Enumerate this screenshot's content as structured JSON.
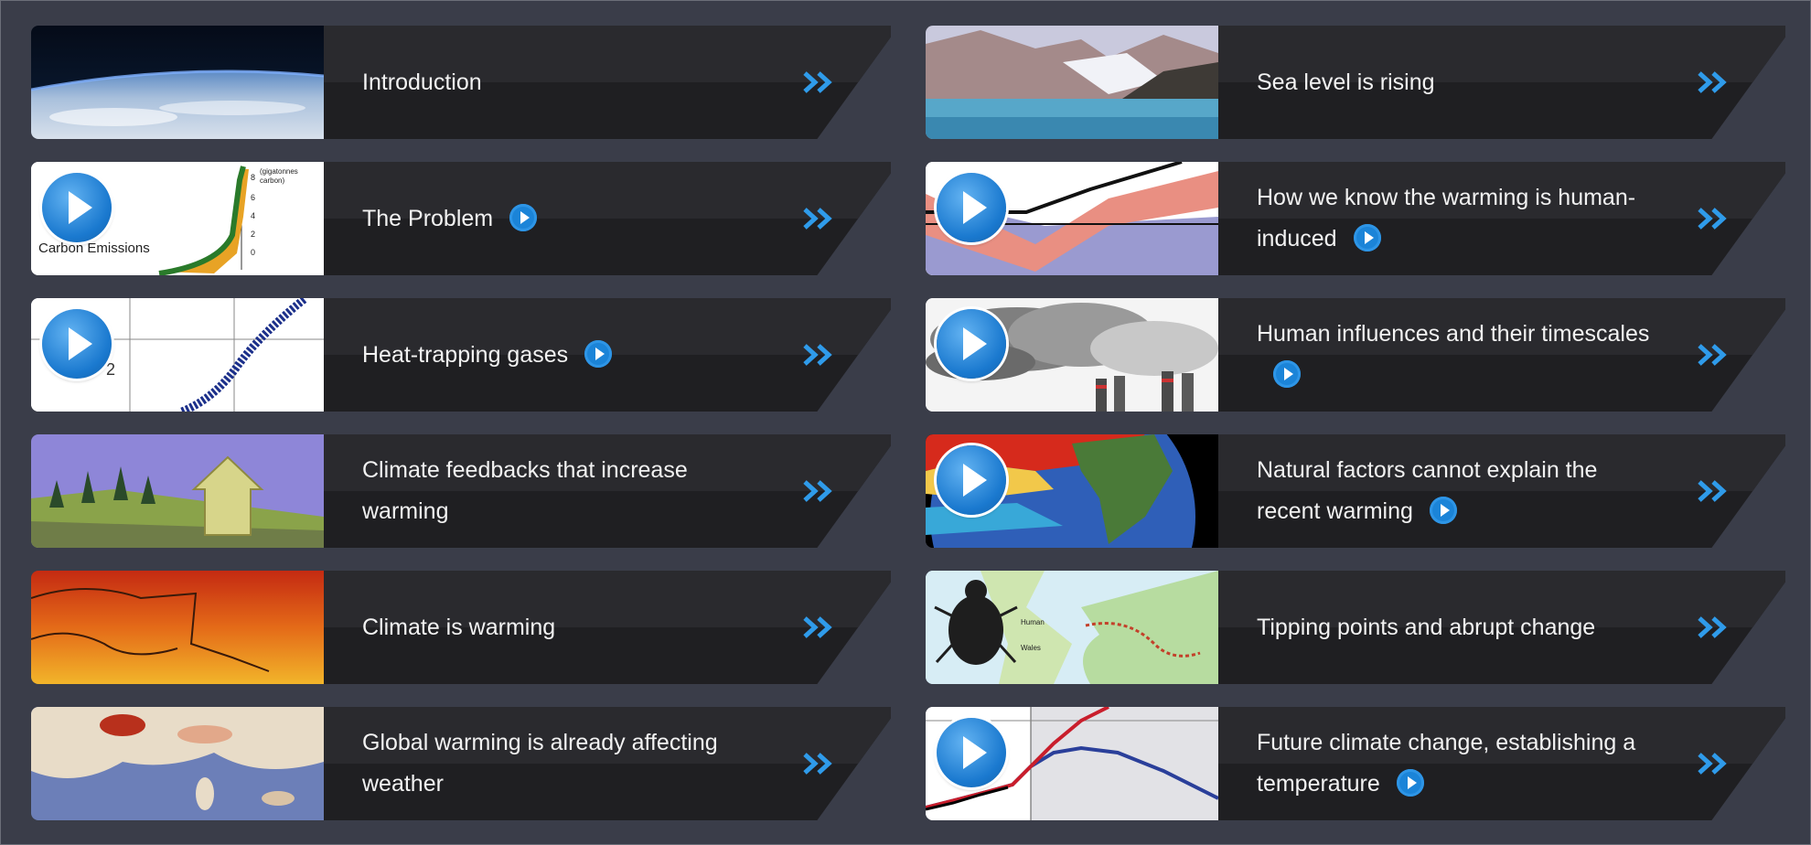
{
  "cards": [
    {
      "label": "Introduction",
      "has_play": false,
      "thumb_play": false
    },
    {
      "label": "Sea level is rising",
      "has_play": false,
      "thumb_play": false
    },
    {
      "label": "The Problem",
      "has_play": true,
      "thumb_play": true
    },
    {
      "label": "How we know the warming is human-induced",
      "has_play": true,
      "thumb_play": true
    },
    {
      "label": "Heat-trapping gases",
      "has_play": true,
      "thumb_play": true
    },
    {
      "label": "Human influences and their timescales",
      "has_play": true,
      "thumb_play": true
    },
    {
      "label": "Climate feedbacks that increase warming",
      "has_play": false,
      "thumb_play": false
    },
    {
      "label": "Natural factors cannot explain the recent warming",
      "has_play": true,
      "thumb_play": true
    },
    {
      "label": "Climate is warming",
      "has_play": false,
      "thumb_play": false
    },
    {
      "label": "Tipping points and abrupt change",
      "has_play": false,
      "thumb_play": false
    },
    {
      "label": "Global warming is already affecting weather",
      "has_play": false,
      "thumb_play": false
    },
    {
      "label": "Future climate change, establishing a temperature",
      "has_play": true,
      "thumb_play": true
    }
  ],
  "thumb_text": {
    "carbon": "Carbon Emissions",
    "gigatonnes": "(gigatonnes carbon)",
    "co2_subscript": "2",
    "human_label": "Human",
    "map_label": "Wales"
  },
  "colors": {
    "accent": "#1b84d8",
    "chevron": "#2f9bea",
    "panel": "#1f1f22",
    "background": "#3a3d49"
  },
  "icons": {
    "more": "double-chevron-right-icon",
    "play": "play-icon"
  }
}
